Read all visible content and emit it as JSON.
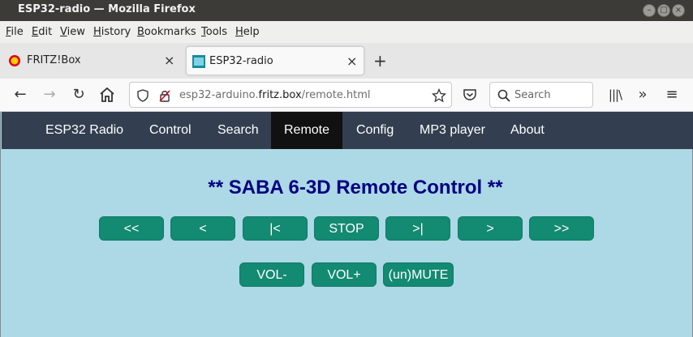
{
  "window": {
    "title": "ESP32-radio — Mozilla Firefox"
  },
  "menubar": {
    "items": [
      "File",
      "Edit",
      "View",
      "History",
      "Bookmarks",
      "Tools",
      "Help"
    ]
  },
  "tabs": [
    {
      "label": "FRITZ!Box"
    },
    {
      "label": "ESP32-radio"
    }
  ],
  "navbar": {
    "url_prefix": "esp32-arduino.",
    "url_domain": "fritz.box",
    "url_path": "/remote.html",
    "search_placeholder": "Search"
  },
  "site_nav": [
    "ESP32 Radio",
    "Control",
    "Search",
    "Remote",
    "Config",
    "MP3 player",
    "About"
  ],
  "site_nav_active": "Remote",
  "heading": "** SABA 6-3D Remote Control **",
  "row1_buttons": [
    "<<",
    "<",
    "|<",
    "STOP",
    ">|",
    ">",
    ">>"
  ],
  "row2_buttons": [
    "VOL-",
    "VOL+",
    "(un)MUTE"
  ],
  "colors": {
    "nav_bg": "#333f50",
    "page_bg": "#add8e6",
    "button_bg": "#138a72",
    "heading": "#000080"
  }
}
